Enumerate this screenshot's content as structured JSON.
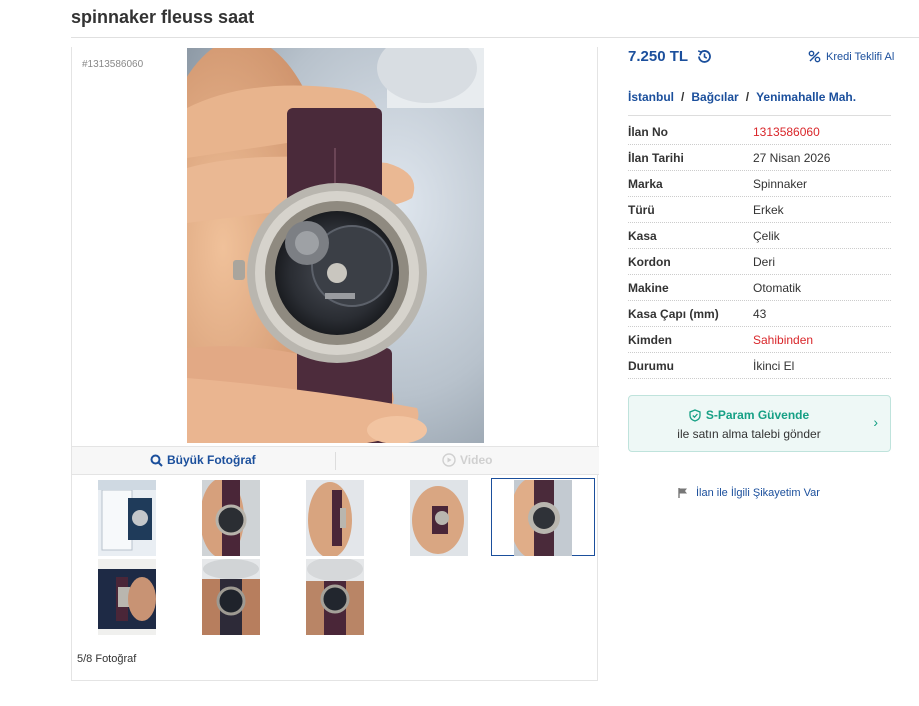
{
  "listing": {
    "title": "spinnaker fleuss saat",
    "ad_id_label": "#1313586060"
  },
  "gallery": {
    "big_photo_label": "Büyük Fotoğraf",
    "video_label": "Video",
    "photo_count": "5/8 Fotoğraf",
    "thumbnails": [
      "thumb-1",
      "thumb-2",
      "thumb-3",
      "thumb-4",
      "thumb-5",
      "thumb-6",
      "thumb-7",
      "thumb-8"
    ],
    "active_index": 5
  },
  "price": {
    "value": "7.250 TL",
    "history_icon": "clock-history-icon",
    "credit_label": "Kredi Teklifi Al"
  },
  "location": {
    "city": "İstanbul",
    "district": "Bağcılar",
    "neighborhood": "Yenimahalle Mah."
  },
  "details": [
    {
      "key": "İlan No",
      "value": "1313586060",
      "color": "#d9262a"
    },
    {
      "key": "İlan Tarihi",
      "value": "27 Nisan 2026"
    },
    {
      "key": "Marka",
      "value": "Spinnaker"
    },
    {
      "key": "Türü",
      "value": "Erkek"
    },
    {
      "key": "Kasa",
      "value": "Çelik"
    },
    {
      "key": "Kordon",
      "value": "Deri"
    },
    {
      "key": "Makine",
      "value": "Otomatik"
    },
    {
      "key": "Kasa Çapı (mm)",
      "value": "43"
    },
    {
      "key": "Kimden",
      "value": "Sahibinden",
      "color": "#d9262a"
    },
    {
      "key": "Durumu",
      "value": "İkinci El"
    }
  ],
  "sparam": {
    "title": "S-Param Güvende",
    "subtitle": "ile satın alma talebi gönder"
  },
  "complaint": {
    "label": "İlan ile İlgili Şikayetim Var"
  },
  "colors": {
    "link": "#1b4f9c",
    "accent_red": "#d9262a",
    "sparam_green": "#16a085"
  }
}
